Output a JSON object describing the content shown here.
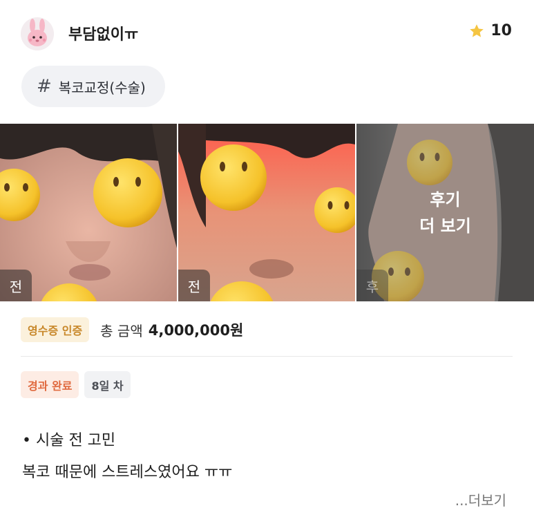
{
  "header": {
    "username": "부담없이ㅠ",
    "rating": "10",
    "avatar_icon": "pink-rabbit-avatar",
    "star_icon": "star-icon",
    "star_color": "#f5c542"
  },
  "tag": {
    "symbol": "#",
    "label": "복코교정(수술)"
  },
  "photos": [
    {
      "label": "전"
    },
    {
      "label": "전"
    },
    {
      "label": "후",
      "overlay_line1": "후기",
      "overlay_line2": "더 보기"
    }
  ],
  "price": {
    "badge": "영수증 인증",
    "label": "총 금액",
    "value": "4,000,000원"
  },
  "status": {
    "badge": "경과 완료",
    "days": "8일 차"
  },
  "review": {
    "line1": "• 시술 전 고민",
    "line2": "복코 때문에 스트레스였어요 ㅠㅠ"
  },
  "see_more": "...더보기"
}
